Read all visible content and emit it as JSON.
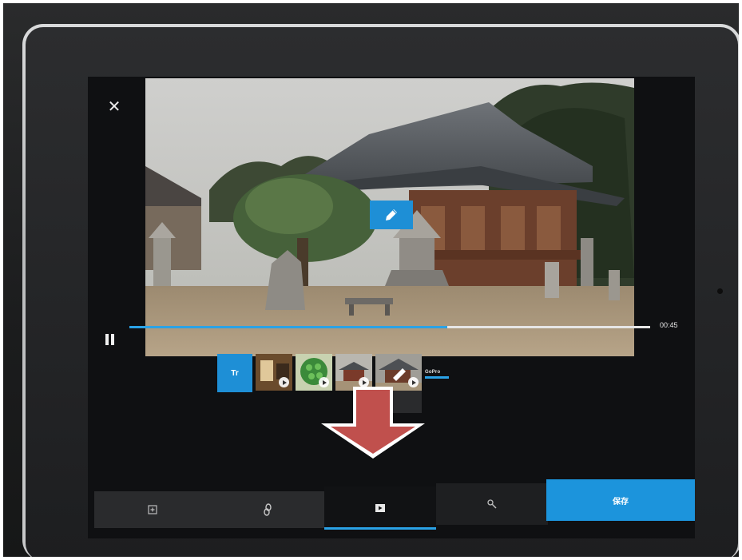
{
  "player": {
    "close_icon": "close-icon",
    "edit_icon": "pencil-icon",
    "pause_icon": "pause-icon",
    "elapsed_time": "00:45",
    "progress": 0.61
  },
  "timeline": {
    "title_card_label": "Tr",
    "clips": [
      {
        "name": "clip-1",
        "thumbnail": "interior"
      },
      {
        "name": "clip-2",
        "thumbnail": "green-circles"
      },
      {
        "name": "clip-3",
        "thumbnail": "temple-wide"
      },
      {
        "name": "clip-4",
        "thumbnail": "temple-selected"
      }
    ],
    "end_card_label": "GoPro"
  },
  "tabs": {
    "add_icon": "add-clip-icon",
    "link_icon": "link-icon",
    "media_icon": "media-icon",
    "tools_icon": "wrench-icon",
    "save_label": "保存"
  },
  "colors": {
    "accent": "#1e8fd6",
    "progress": "#2aa2e6",
    "annotation_arrow": "#c0504d"
  }
}
